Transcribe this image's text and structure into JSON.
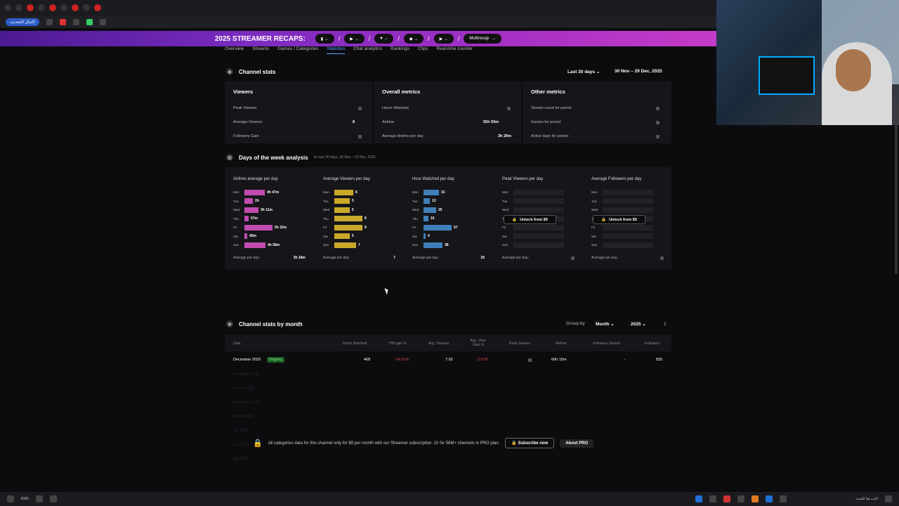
{
  "promo": {
    "title": "2025 STREAMER RECAPS:",
    "multirecap": "Multirecap"
  },
  "browser": {
    "back_button": "إكمال التحديث"
  },
  "nav": {
    "tabs": [
      "Overview",
      "Streams",
      "Games / Categories",
      "Statistics",
      "Chat analytics",
      "Rankings",
      "Clips",
      "Real-time counter"
    ],
    "active": "Statistics"
  },
  "channel_stats": {
    "title": "Channel stats",
    "range": "Last 30 days",
    "dates": "30 Nov – 29 Dec, 2025",
    "columns": [
      {
        "title": "Viewers",
        "rows": [
          {
            "label": "Peak Viewers",
            "value": "",
            "locked": true
          },
          {
            "label": "Average Viewers",
            "value": "8",
            "locked": true
          },
          {
            "label": "Followers Gain",
            "value": "",
            "locked": true
          }
        ]
      },
      {
        "title": "Overall metrics",
        "rows": [
          {
            "label": "Hours Watched",
            "value": "",
            "locked": true
          },
          {
            "label": "Airtime",
            "value": "55h 50m",
            "locked": false
          },
          {
            "label": "Average Airtime per day",
            "value": "3h 29m",
            "locked": false
          }
        ]
      },
      {
        "title": "Other metrics",
        "rows": [
          {
            "label": "Stream count for period",
            "value": "",
            "locked": true
          },
          {
            "label": "Games for period",
            "value": "",
            "locked": true
          },
          {
            "label": "Active days for period",
            "value": "",
            "locked": true
          }
        ]
      }
    ]
  },
  "days_analysis": {
    "title": "Days of the week analysis",
    "subtitle": "for last 30 days, 30 Nov – 29 Dec, 2025",
    "days": [
      "Mon",
      "Tue",
      "Wed",
      "Thu",
      "Fri",
      "Sat",
      "Sun"
    ],
    "avg_label": "Average per day:",
    "unlock_label": "Unlock from $9",
    "cards": [
      {
        "title": "Airtime average per day",
        "color": "#c14bb0",
        "values": [
          "4h 47m",
          "2h",
          "3h 11m",
          "57m",
          "6h 32m",
          "45m",
          "4h 58m"
        ],
        "fractions": [
          0.73,
          0.31,
          0.49,
          0.15,
          1.0,
          0.11,
          0.76
        ],
        "avg": "3h 18m"
      },
      {
        "title": "Average Viewers per day",
        "color": "#c9a92a",
        "values": [
          "6",
          "5",
          "5",
          "9",
          "9",
          "5",
          "7"
        ],
        "fractions": [
          0.67,
          0.56,
          0.56,
          1.0,
          1.0,
          0.56,
          0.78
        ],
        "avg": "7"
      },
      {
        "title": "Hour Watched per day",
        "color": "#3f7fb8",
        "values": [
          "31",
          "13",
          "25",
          "10",
          "57",
          "4",
          "38"
        ],
        "fractions": [
          0.54,
          0.23,
          0.44,
          0.18,
          1.0,
          0.07,
          0.67
        ],
        "avg": "25"
      },
      {
        "title": "Peak Viewers per day",
        "locked": true
      },
      {
        "title": "Average Followers per day",
        "locked": true
      }
    ]
  },
  "monthly": {
    "title": "Channel stats by month",
    "group_by_label": "Group by",
    "group_by": "Month",
    "year": "2025",
    "headers": [
      "Date",
      "Hours Watched",
      "HW gain %",
      "Avg. Viewers",
      "Avg. View. Gain %",
      "Peak Viewers",
      "Airtime",
      "Followers Gained",
      "Followers"
    ],
    "row": {
      "date": "December 2025",
      "badge": "Ongoing",
      "hours_watched": "468",
      "hw_gain": "-14.91%",
      "avg_viewers": "7.92",
      "avg_view_gain": "-2.87%",
      "airtime": "60h 15m",
      "followers_gained": "-",
      "followers": "835"
    },
    "faded_rows": [
      "November 2025",
      "October 2025",
      "September 2025",
      "August 2025",
      "July 2025",
      "June 2025",
      "May 2025"
    ]
  },
  "subscribe": {
    "text": "All categories data for this channel only for $9 per month with our Streamer subscription. Or for 56M+ channels in PRO plan.",
    "subscribe_btn": "Subscribe now",
    "about_btn": "About PRO"
  },
  "taskbar": {
    "lang": "ENG",
    "search_placeholder": "اكتب هنا للبحث"
  }
}
